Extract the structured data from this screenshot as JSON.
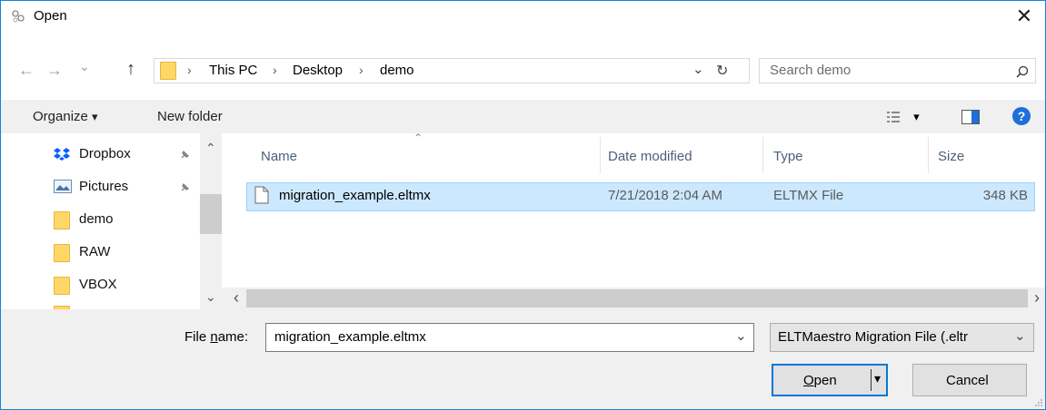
{
  "window": {
    "title": "Open",
    "close_glyph": "✕"
  },
  "nav": {
    "back_glyph": "←",
    "forward_glyph": "→",
    "recent_glyph": "⌄",
    "up_glyph": "↑",
    "breadcrumb": [
      "This PC",
      "Desktop",
      "demo"
    ],
    "crumb_sep": "›",
    "dropdown_glyph": "⌄",
    "refresh_glyph": "↻",
    "search_placeholder": "Search demo",
    "search_glyph": "⚲"
  },
  "toolbar": {
    "organize_label": "Organize",
    "organize_caret": "▾",
    "new_folder_label": "New folder",
    "view_caret": "▾",
    "help_glyph": "?"
  },
  "sidebar": {
    "items": [
      {
        "label": "Dropbox",
        "icon": "dropbox-icon",
        "pinned": true
      },
      {
        "label": "Pictures",
        "icon": "pictures-icon",
        "pinned": true
      },
      {
        "label": "demo",
        "icon": "folder-icon",
        "pinned": false
      },
      {
        "label": "RAW",
        "icon": "folder-icon",
        "pinned": false
      },
      {
        "label": "VBOX",
        "icon": "folder-icon",
        "pinned": false
      }
    ],
    "pin_glyph": "📌",
    "scroll_up_glyph": "⌃",
    "scroll_down_glyph": "⌄"
  },
  "file_list": {
    "sort_glyph": "⌃",
    "columns": [
      "Name",
      "Date modified",
      "Type",
      "Size"
    ],
    "rows": [
      {
        "name": "migration_example.eltmx",
        "date": "7/21/2018 2:04 AM",
        "type": "ELTMX File",
        "size": "348 KB",
        "selected": true
      }
    ],
    "scroll_left_glyph": "‹",
    "scroll_right_glyph": "›"
  },
  "bottom": {
    "filename_label_pre": "File ",
    "filename_label_u": "n",
    "filename_label_post": "ame:",
    "filename_value": "migration_example.eltmx",
    "filename_dropdown_glyph": "⌄",
    "filter_value": "ELTMaestro Migration File (.eltr",
    "filter_dropdown_glyph": "⌄",
    "open_u": "O",
    "open_rest": "pen",
    "open_split_glyph": "▾",
    "cancel_label": "Cancel"
  },
  "colors": {
    "accent": "#0078d7",
    "selection": "#cce8ff",
    "folder": "#ffd766",
    "help": "#1e6fd9",
    "dropbox": "#0061fe"
  }
}
